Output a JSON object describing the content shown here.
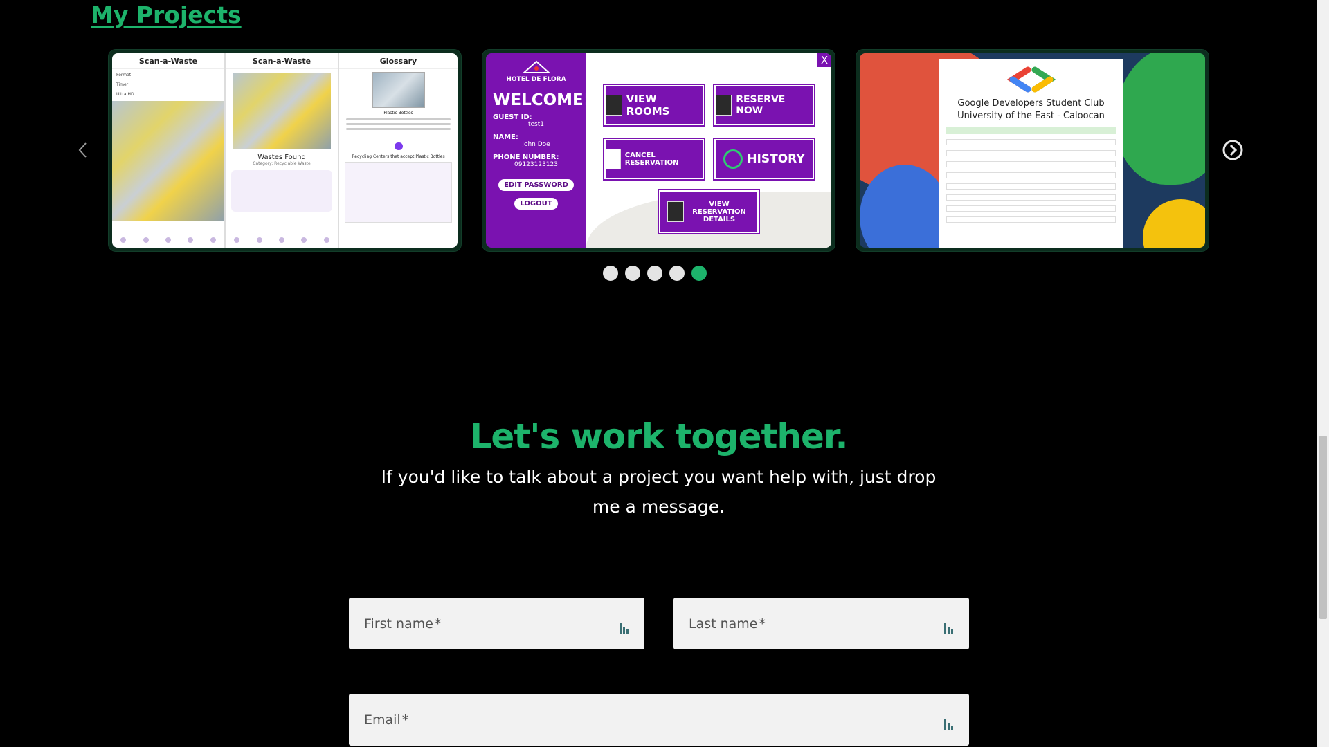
{
  "projects": {
    "title": "My Projects",
    "carousel": {
      "slides": [
        {
          "name": "scan-a-waste",
          "screens": [
            {
              "title": "Scan-a-Waste",
              "rows": [
                "Format",
                "Timer",
                "Ultra HD"
              ]
            },
            {
              "title": "Scan-a-Waste",
              "heading": "Wastes Found",
              "sub": "Category: Recyclable Waste"
            },
            {
              "title": "Glossary",
              "heading": "Plastic Bottles",
              "sub": "Recycling Centers that accept Plastic Bottles"
            }
          ]
        },
        {
          "name": "hotel-de-flora",
          "logo": "HOTEL DE FLORA",
          "welcome": "WELCOME!",
          "guest_id_label": "GUEST ID:",
          "guest_id": "test1",
          "name_label": "NAME:",
          "guest_name": "John Doe",
          "phone_label": "PHONE NUMBER:",
          "phone": "09123123123",
          "edit_password": "EDIT PASSWORD",
          "logout": "LOGOUT",
          "close": "X",
          "buttons": {
            "view_rooms": "VIEW ROOMS",
            "reserve_now": "RESERVE NOW",
            "cancel_reservation": "CANCEL RESERVATION",
            "history": "HISTORY",
            "view_reservation_details": "VIEW RESERVATION DETAILS"
          }
        },
        {
          "name": "gdsc-form",
          "title": "Google Developers Student Club",
          "subtitle": "University of the East - Caloocan"
        }
      ],
      "dots": 5,
      "active_dot": 4
    }
  },
  "contact": {
    "title": "Let's work together.",
    "text": "If you'd like to talk about a project you want help with, just drop me a message.",
    "fields": {
      "first_name": "First name",
      "last_name": "Last name",
      "email": "Email",
      "required_mark": "*"
    }
  },
  "colors": {
    "accent": "#1db36b",
    "background": "#000000",
    "field_bg": "#f2f2f2",
    "hotel_purple": "#7a12b0"
  }
}
